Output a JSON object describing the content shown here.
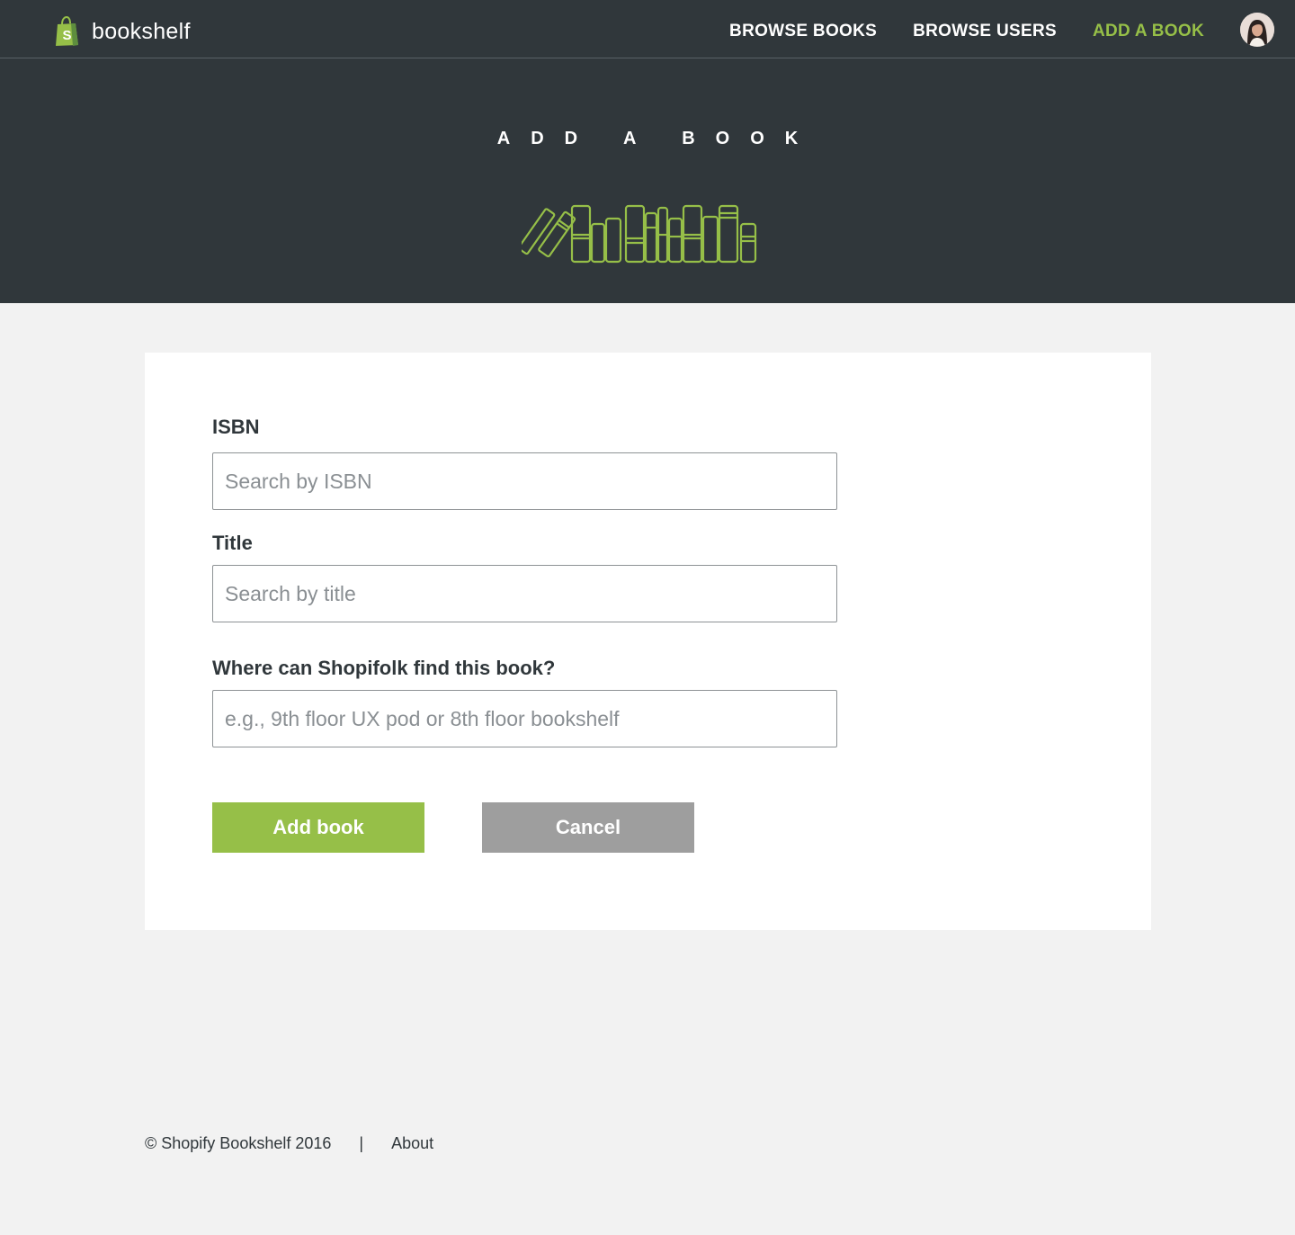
{
  "brand": {
    "name": "bookshelf",
    "logo_icon": "shopify-bag-icon",
    "color": "#96bf48"
  },
  "nav": {
    "items": [
      {
        "label": "BROWSE BOOKS",
        "active": false
      },
      {
        "label": "BROWSE USERS",
        "active": false
      },
      {
        "label": "ADD A BOOK",
        "active": true
      }
    ],
    "avatar_icon": "user-avatar"
  },
  "hero": {
    "title": "ADD A BOOK",
    "illustration_icon": "bookshelf-icon"
  },
  "form": {
    "isbn": {
      "label": "ISBN",
      "placeholder": "Search by ISBN",
      "value": ""
    },
    "title": {
      "label": "Title",
      "placeholder": "Search by title",
      "value": ""
    },
    "location": {
      "label": "Where can Shopifolk find this book?",
      "placeholder": "e.g., 9th floor UX pod or 8th floor bookshelf",
      "value": ""
    },
    "submit_label": "Add book",
    "cancel_label": "Cancel"
  },
  "footer": {
    "copyright": "© Shopify Bookshelf 2016",
    "separator": "|",
    "about_label": "About"
  },
  "colors": {
    "header_bg": "#30373b",
    "accent": "#96bf48",
    "page_bg": "#f2f2f2",
    "cancel_bg": "#9e9e9e"
  }
}
